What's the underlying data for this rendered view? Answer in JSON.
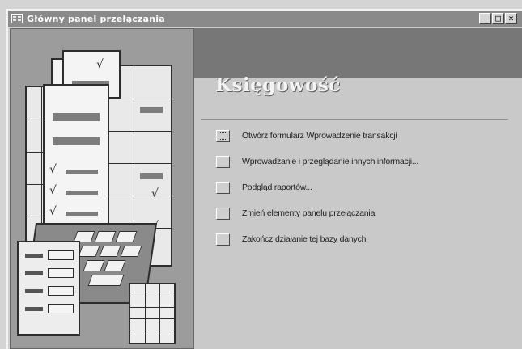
{
  "window": {
    "title": "Główny panel przełączania",
    "controls": {
      "minimize": "_",
      "maximize": "□",
      "close": "×"
    }
  },
  "header": {
    "title": "Księgowość"
  },
  "menu": {
    "items": [
      {
        "label": "Otwórz formularz Wprowadzenie transakcji",
        "focused": true
      },
      {
        "label": "Wprowadzanie i przeglądanie innych informacji...",
        "focused": false
      },
      {
        "label": "Podgląd raportów...",
        "focused": false
      },
      {
        "label": "Zmień elementy panelu przełączania",
        "focused": false
      },
      {
        "label": "Zakończ działanie tej bazy danych",
        "focused": false
      }
    ]
  },
  "illustration": {
    "icon": "accounting-documents-calculator-icon"
  },
  "colors": {
    "titlebar": "#8a8a8a",
    "header_band": "#777777",
    "left_pane": "#9c9c9c"
  }
}
